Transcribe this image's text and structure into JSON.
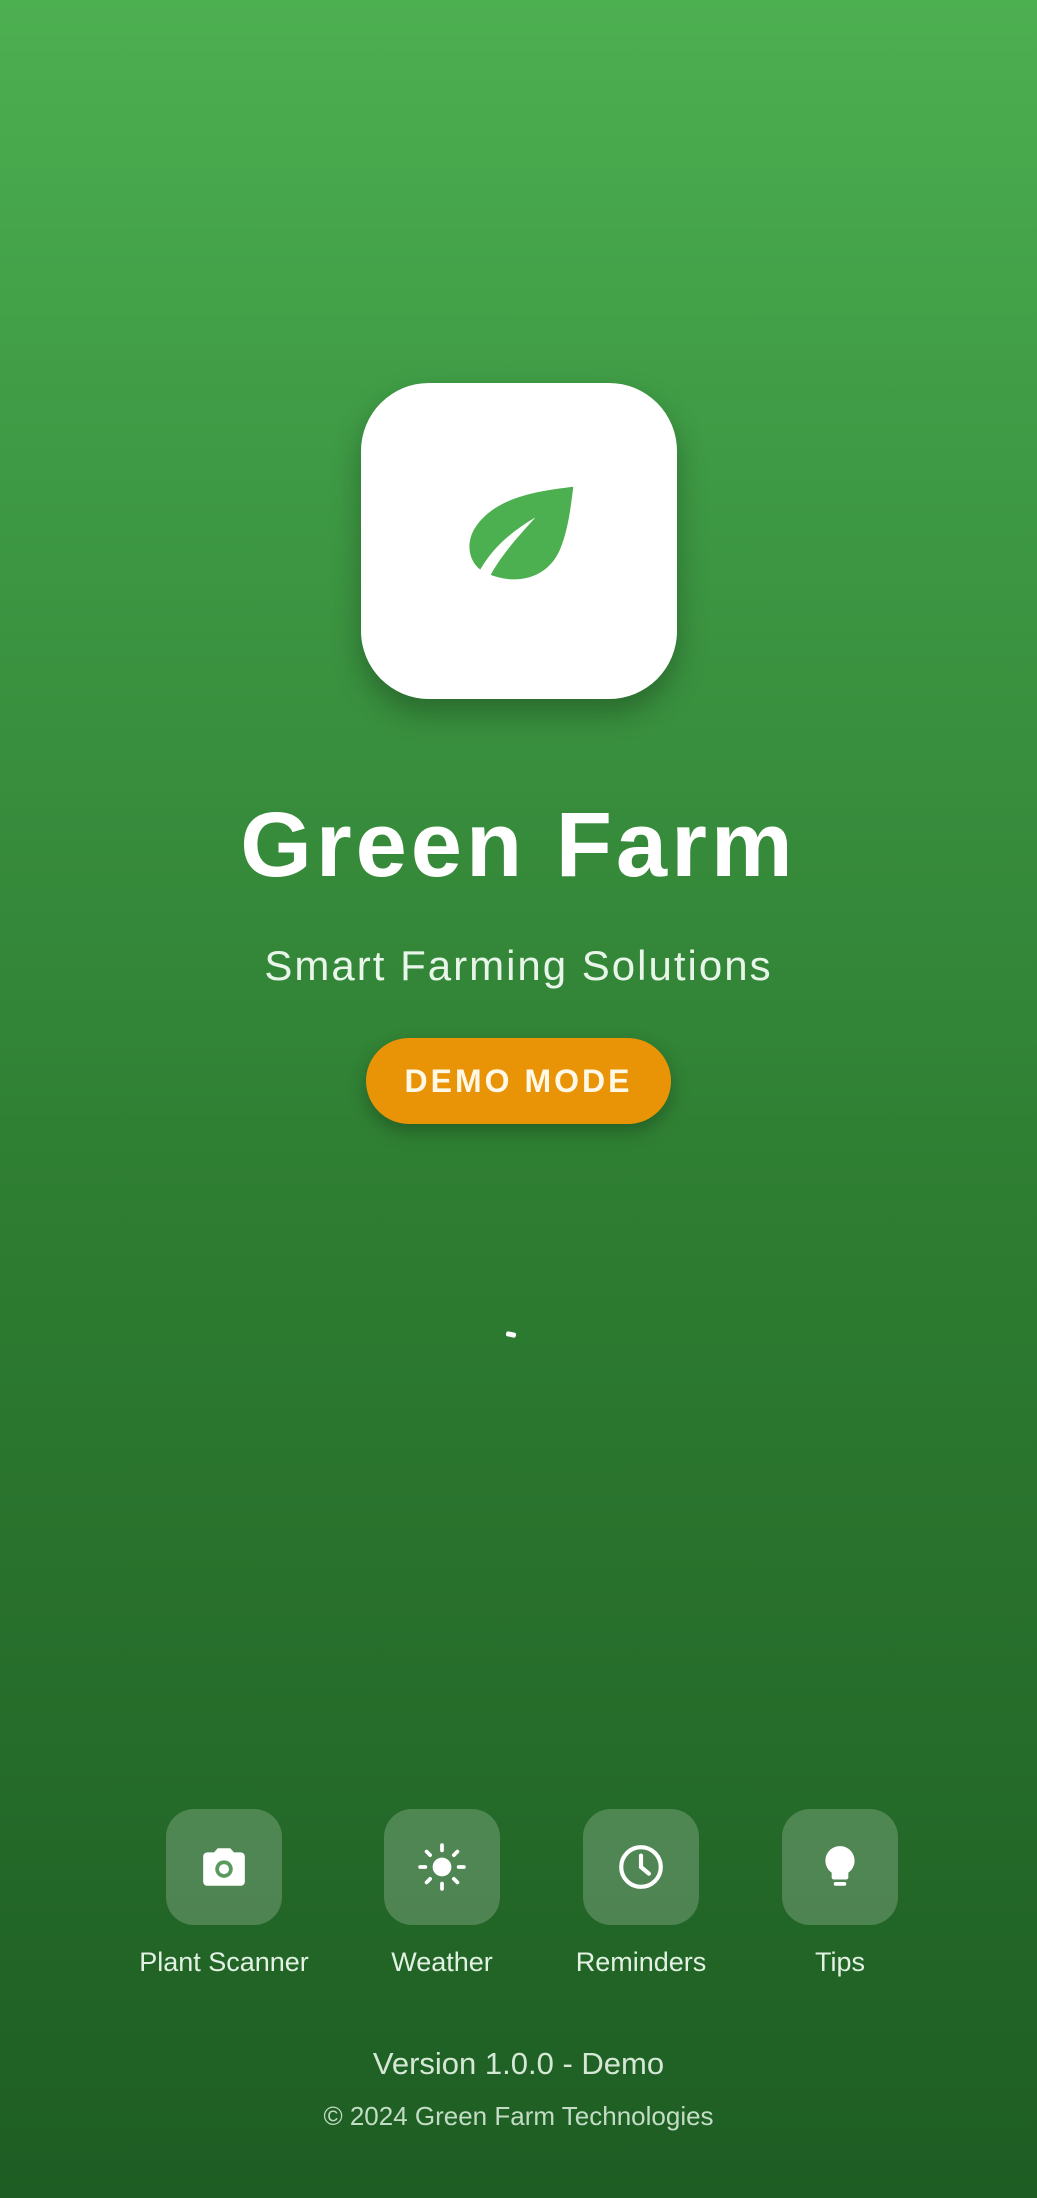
{
  "app": {
    "title": "Green Farm",
    "subtitle": "Smart Farming Solutions",
    "logo_icon": "leaf-icon",
    "mode_badge": "DEMO MODE"
  },
  "loading": {
    "indicator": "spinner"
  },
  "features": [
    {
      "label": "Plant Scanner",
      "icon": "camera-icon"
    },
    {
      "label": "Weather",
      "icon": "sun-icon"
    },
    {
      "label": "Reminders",
      "icon": "clock-icon"
    },
    {
      "label": "Tips",
      "icon": "lightbulb-icon"
    }
  ],
  "footer": {
    "version": "Version 1.0.0 - Demo",
    "copyright": "© 2024 Green Farm Technologies"
  },
  "colors": {
    "background_top": "#4CAF50",
    "background_bottom": "#1E5D23",
    "accent": "#E99407",
    "logo_leaf": "#4CAF50",
    "logo_card": "#FFFFFF"
  }
}
